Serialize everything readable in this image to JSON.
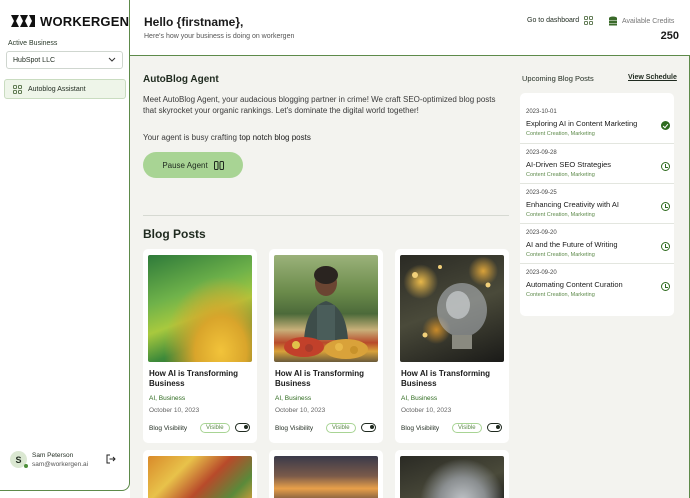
{
  "brand": {
    "name": "WORKERGEN"
  },
  "sidebar": {
    "active_business_label": "Active Business",
    "business_selected": "HubSpot LLC",
    "items": [
      {
        "label": "Autoblog Assistant",
        "icon": "grid-icon"
      }
    ],
    "user": {
      "initial": "S",
      "name": "Sam Peterson",
      "email": "sam@workergen.ai"
    }
  },
  "header": {
    "greeting": "Hello {firstname},",
    "subtitle": "Here's how your business is doing on workergen",
    "dashboard_link": "Go to dashboard",
    "credits_label": "Available Credits",
    "credits_value": "250"
  },
  "agent": {
    "title": "AutoBlog Agent",
    "description": "Meet AutoBlog Agent, your audacious blogging partner in crime! We craft SEO-optimized blog posts that skyrocket your organic rankings. Let's dominate the digital world together!",
    "status_prefix": "Your agent is busy crafting ",
    "status_highlight": "top notch blog posts",
    "pause_label": "Pause Agent"
  },
  "posts": {
    "title": "Blog Posts",
    "cards": [
      {
        "title": "How AI is Transforming Business",
        "category": "AI, Business",
        "date": "October 10, 2023",
        "visibility_label": "Blog Visibility",
        "visibility_status": "Visible",
        "image": "green-abstract-image"
      },
      {
        "title": "How AI is Transforming Business",
        "category": "AI, Business",
        "date": "October 10, 2023",
        "visibility_label": "Blog Visibility",
        "visibility_status": "Visible",
        "image": "market-vendor-photo"
      },
      {
        "title": "How AI is Transforming Business",
        "category": "AI, Business",
        "date": "October 10, 2023",
        "visibility_label": "Blog Visibility",
        "visibility_status": "Visible",
        "image": "lightbulb-photo"
      }
    ]
  },
  "upcoming": {
    "title": "Upcoming Blog Posts",
    "view_link": "View Schedule",
    "items": [
      {
        "date": "2023-10-01",
        "name": "Exploring AI in Content Marketing",
        "category": "Content Creation, Marketing",
        "status": "done"
      },
      {
        "date": "2023-09-28",
        "name": "AI-Driven SEO Strategies",
        "category": "Content Creation, Marketing",
        "status": "scheduled"
      },
      {
        "date": "2023-09-25",
        "name": "Enhancing Creativity with AI",
        "category": "Content Creation, Marketing",
        "status": "scheduled"
      },
      {
        "date": "2023-09-20",
        "name": "AI and the Future of Writing",
        "category": "Content Creation, Marketing",
        "status": "scheduled"
      },
      {
        "date": "2023-09-20",
        "name": "Automating Content Curation",
        "category": "Content Creation, Marketing",
        "status": "scheduled"
      }
    ]
  },
  "colors": {
    "accent": "#5d8a4a",
    "button": "#a8d494",
    "background": "#f3f3ef"
  }
}
